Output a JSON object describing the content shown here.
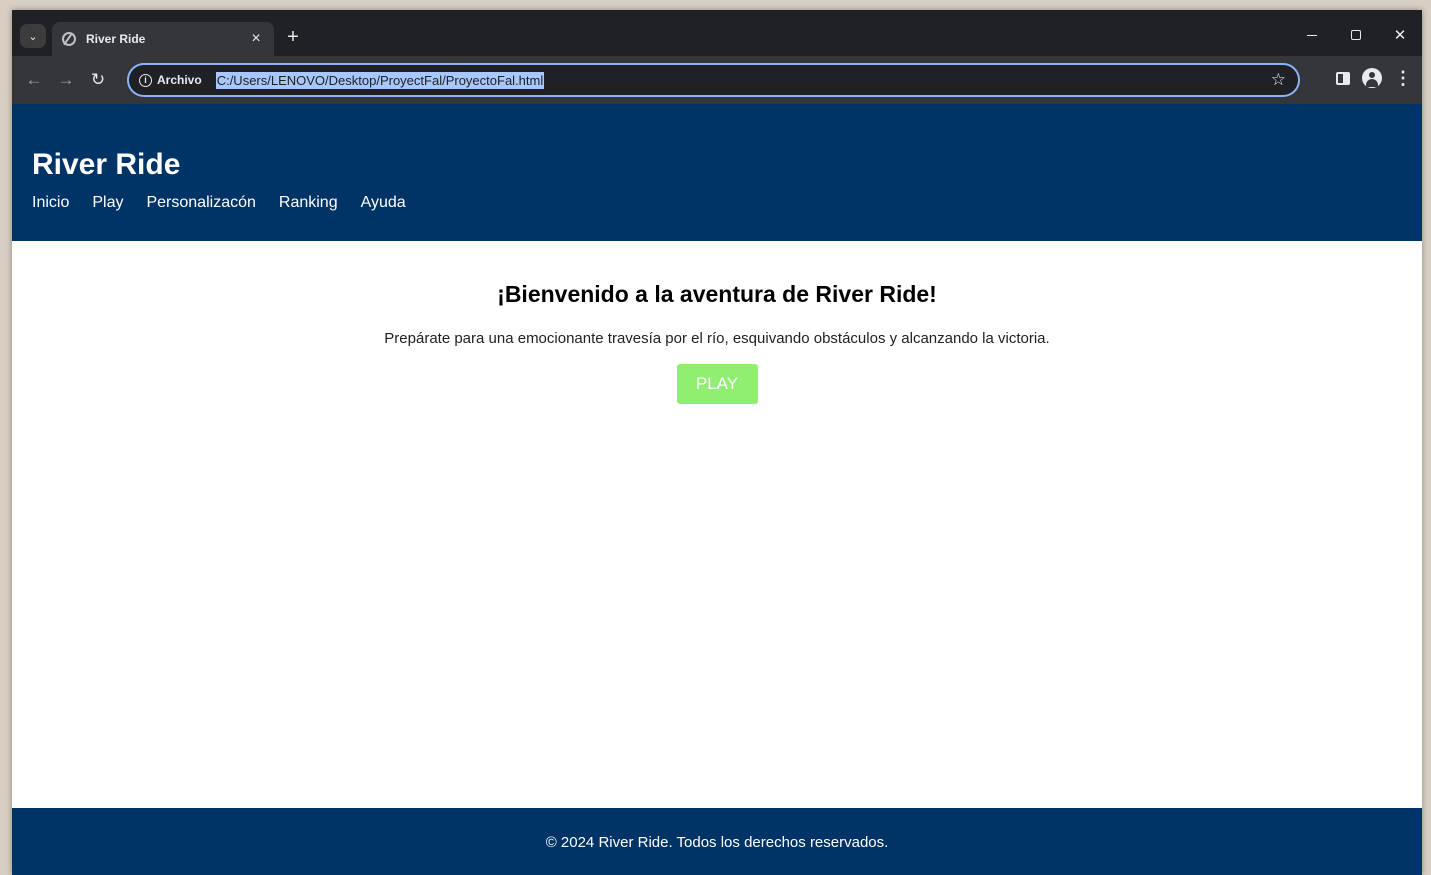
{
  "browser": {
    "tab_title": "River Ride",
    "omnibox_chip": "Archivo",
    "url": "C:/Users/LENOVO/Desktop/ProyectFal/ProyectoFal.html"
  },
  "site": {
    "title": "River Ride",
    "nav": [
      "Inicio",
      "Play",
      "Personalizacón",
      "Ranking",
      "Ayuda"
    ],
    "headline": "¡Bienvenido a la aventura de River Ride!",
    "intro": "Prepárate para una emocionante travesía por el río, esquivando obstáculos y alcanzando la victoria.",
    "play_button": "PLAY",
    "footer": "© 2024 River Ride. Todos los derechos reservados.",
    "colors": {
      "header_bg": "#003366",
      "play_button_bg": "#90ee70"
    }
  }
}
